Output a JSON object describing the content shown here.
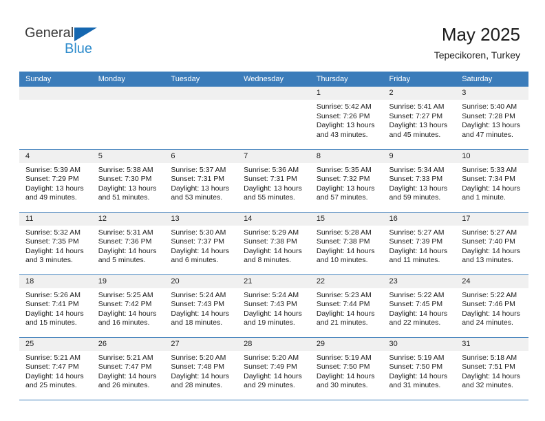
{
  "brand": {
    "name_part1": "General",
    "name_part2": "Blue",
    "triangle_color": "#1567b0",
    "text_color_part1": "#3b3b3b",
    "text_color_part2": "#2f8ccc"
  },
  "header": {
    "month_title": "May 2025",
    "location": "Tepecikoren, Turkey"
  },
  "theme": {
    "header_bg": "#3b7cba",
    "header_text": "#ffffff",
    "daynum_band_bg": "#f0f0f0",
    "cell_bg": "#ffffff",
    "row_divider": "#3b7cba"
  },
  "weekdays": [
    "Sunday",
    "Monday",
    "Tuesday",
    "Wednesday",
    "Thursday",
    "Friday",
    "Saturday"
  ],
  "weeks": [
    [
      {
        "day": "",
        "empty": true
      },
      {
        "day": "",
        "empty": true
      },
      {
        "day": "",
        "empty": true
      },
      {
        "day": "",
        "empty": true
      },
      {
        "day": "1",
        "sunrise": "Sunrise: 5:42 AM",
        "sunset": "Sunset: 7:26 PM",
        "daylight_line1": "Daylight: 13 hours",
        "daylight_line2": "and 43 minutes."
      },
      {
        "day": "2",
        "sunrise": "Sunrise: 5:41 AM",
        "sunset": "Sunset: 7:27 PM",
        "daylight_line1": "Daylight: 13 hours",
        "daylight_line2": "and 45 minutes."
      },
      {
        "day": "3",
        "sunrise": "Sunrise: 5:40 AM",
        "sunset": "Sunset: 7:28 PM",
        "daylight_line1": "Daylight: 13 hours",
        "daylight_line2": "and 47 minutes."
      }
    ],
    [
      {
        "day": "4",
        "sunrise": "Sunrise: 5:39 AM",
        "sunset": "Sunset: 7:29 PM",
        "daylight_line1": "Daylight: 13 hours",
        "daylight_line2": "and 49 minutes."
      },
      {
        "day": "5",
        "sunrise": "Sunrise: 5:38 AM",
        "sunset": "Sunset: 7:30 PM",
        "daylight_line1": "Daylight: 13 hours",
        "daylight_line2": "and 51 minutes."
      },
      {
        "day": "6",
        "sunrise": "Sunrise: 5:37 AM",
        "sunset": "Sunset: 7:31 PM",
        "daylight_line1": "Daylight: 13 hours",
        "daylight_line2": "and 53 minutes."
      },
      {
        "day": "7",
        "sunrise": "Sunrise: 5:36 AM",
        "sunset": "Sunset: 7:31 PM",
        "daylight_line1": "Daylight: 13 hours",
        "daylight_line2": "and 55 minutes."
      },
      {
        "day": "8",
        "sunrise": "Sunrise: 5:35 AM",
        "sunset": "Sunset: 7:32 PM",
        "daylight_line1": "Daylight: 13 hours",
        "daylight_line2": "and 57 minutes."
      },
      {
        "day": "9",
        "sunrise": "Sunrise: 5:34 AM",
        "sunset": "Sunset: 7:33 PM",
        "daylight_line1": "Daylight: 13 hours",
        "daylight_line2": "and 59 minutes."
      },
      {
        "day": "10",
        "sunrise": "Sunrise: 5:33 AM",
        "sunset": "Sunset: 7:34 PM",
        "daylight_line1": "Daylight: 14 hours",
        "daylight_line2": "and 1 minute."
      }
    ],
    [
      {
        "day": "11",
        "sunrise": "Sunrise: 5:32 AM",
        "sunset": "Sunset: 7:35 PM",
        "daylight_line1": "Daylight: 14 hours",
        "daylight_line2": "and 3 minutes."
      },
      {
        "day": "12",
        "sunrise": "Sunrise: 5:31 AM",
        "sunset": "Sunset: 7:36 PM",
        "daylight_line1": "Daylight: 14 hours",
        "daylight_line2": "and 5 minutes."
      },
      {
        "day": "13",
        "sunrise": "Sunrise: 5:30 AM",
        "sunset": "Sunset: 7:37 PM",
        "daylight_line1": "Daylight: 14 hours",
        "daylight_line2": "and 6 minutes."
      },
      {
        "day": "14",
        "sunrise": "Sunrise: 5:29 AM",
        "sunset": "Sunset: 7:38 PM",
        "daylight_line1": "Daylight: 14 hours",
        "daylight_line2": "and 8 minutes."
      },
      {
        "day": "15",
        "sunrise": "Sunrise: 5:28 AM",
        "sunset": "Sunset: 7:38 PM",
        "daylight_line1": "Daylight: 14 hours",
        "daylight_line2": "and 10 minutes."
      },
      {
        "day": "16",
        "sunrise": "Sunrise: 5:27 AM",
        "sunset": "Sunset: 7:39 PM",
        "daylight_line1": "Daylight: 14 hours",
        "daylight_line2": "and 11 minutes."
      },
      {
        "day": "17",
        "sunrise": "Sunrise: 5:27 AM",
        "sunset": "Sunset: 7:40 PM",
        "daylight_line1": "Daylight: 14 hours",
        "daylight_line2": "and 13 minutes."
      }
    ],
    [
      {
        "day": "18",
        "sunrise": "Sunrise: 5:26 AM",
        "sunset": "Sunset: 7:41 PM",
        "daylight_line1": "Daylight: 14 hours",
        "daylight_line2": "and 15 minutes."
      },
      {
        "day": "19",
        "sunrise": "Sunrise: 5:25 AM",
        "sunset": "Sunset: 7:42 PM",
        "daylight_line1": "Daylight: 14 hours",
        "daylight_line2": "and 16 minutes."
      },
      {
        "day": "20",
        "sunrise": "Sunrise: 5:24 AM",
        "sunset": "Sunset: 7:43 PM",
        "daylight_line1": "Daylight: 14 hours",
        "daylight_line2": "and 18 minutes."
      },
      {
        "day": "21",
        "sunrise": "Sunrise: 5:24 AM",
        "sunset": "Sunset: 7:43 PM",
        "daylight_line1": "Daylight: 14 hours",
        "daylight_line2": "and 19 minutes."
      },
      {
        "day": "22",
        "sunrise": "Sunrise: 5:23 AM",
        "sunset": "Sunset: 7:44 PM",
        "daylight_line1": "Daylight: 14 hours",
        "daylight_line2": "and 21 minutes."
      },
      {
        "day": "23",
        "sunrise": "Sunrise: 5:22 AM",
        "sunset": "Sunset: 7:45 PM",
        "daylight_line1": "Daylight: 14 hours",
        "daylight_line2": "and 22 minutes."
      },
      {
        "day": "24",
        "sunrise": "Sunrise: 5:22 AM",
        "sunset": "Sunset: 7:46 PM",
        "daylight_line1": "Daylight: 14 hours",
        "daylight_line2": "and 24 minutes."
      }
    ],
    [
      {
        "day": "25",
        "sunrise": "Sunrise: 5:21 AM",
        "sunset": "Sunset: 7:47 PM",
        "daylight_line1": "Daylight: 14 hours",
        "daylight_line2": "and 25 minutes."
      },
      {
        "day": "26",
        "sunrise": "Sunrise: 5:21 AM",
        "sunset": "Sunset: 7:47 PM",
        "daylight_line1": "Daylight: 14 hours",
        "daylight_line2": "and 26 minutes."
      },
      {
        "day": "27",
        "sunrise": "Sunrise: 5:20 AM",
        "sunset": "Sunset: 7:48 PM",
        "daylight_line1": "Daylight: 14 hours",
        "daylight_line2": "and 28 minutes."
      },
      {
        "day": "28",
        "sunrise": "Sunrise: 5:20 AM",
        "sunset": "Sunset: 7:49 PM",
        "daylight_line1": "Daylight: 14 hours",
        "daylight_line2": "and 29 minutes."
      },
      {
        "day": "29",
        "sunrise": "Sunrise: 5:19 AM",
        "sunset": "Sunset: 7:50 PM",
        "daylight_line1": "Daylight: 14 hours",
        "daylight_line2": "and 30 minutes."
      },
      {
        "day": "30",
        "sunrise": "Sunrise: 5:19 AM",
        "sunset": "Sunset: 7:50 PM",
        "daylight_line1": "Daylight: 14 hours",
        "daylight_line2": "and 31 minutes."
      },
      {
        "day": "31",
        "sunrise": "Sunrise: 5:18 AM",
        "sunset": "Sunset: 7:51 PM",
        "daylight_line1": "Daylight: 14 hours",
        "daylight_line2": "and 32 minutes."
      }
    ]
  ]
}
